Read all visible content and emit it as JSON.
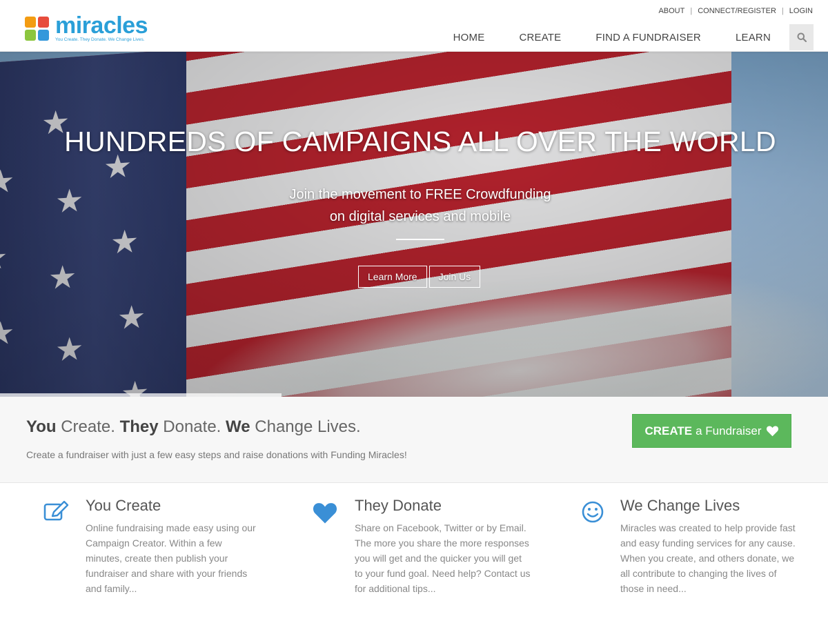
{
  "brand": {
    "name": "miracles",
    "tagline": "You Create. They Donate. We Change Lives."
  },
  "top_links": [
    "ABOUT",
    "CONNECT/REGISTER",
    "LOGIN"
  ],
  "nav": {
    "items": [
      "HOME",
      "CREATE",
      "FIND A FUNDRAISER",
      "LEARN"
    ],
    "search_icon": "search-icon"
  },
  "hero": {
    "title": "HUNDREDS OF CAMPAIGNS ALL OVER THE WORLD",
    "subtitle_line1": "Join the movement to FREE Crowdfunding",
    "subtitle_line2": "on digital services and mobile",
    "buttons": [
      "Learn More",
      "Join Us"
    ]
  },
  "band": {
    "title_parts": [
      "You",
      " Create. ",
      "They",
      " Donate. ",
      "We",
      " Change Lives."
    ],
    "description": "Create a fundraiser with just a few easy steps and raise donations with Funding Miracles!",
    "cta_bold": "CREATE",
    "cta_rest": "a Fundraiser",
    "cta_icon": "heart-icon"
  },
  "features": [
    {
      "icon": "edit-icon",
      "title": "You Create",
      "text": "Online fundraising made easy using our Campaign Creator. Within a few minutes, create then publish your fundraiser and share with your friends and family..."
    },
    {
      "icon": "heart-icon",
      "title": "They Donate",
      "text": "Share on Facebook, Twitter or by Email. The more you share the more responses you will get and the quicker you will get to your fund goal. Need help? Contact us for additional tips..."
    },
    {
      "icon": "smile-icon",
      "title": "We Change Lives",
      "text": "Miracles was created to help provide fast and easy funding services for any cause. When you create, and others donate, we all contribute to changing the lives of those in need..."
    }
  ],
  "colors": {
    "brand_blue": "#2a9fd8",
    "cta_green": "#5cb85c",
    "icon_blue": "#3a8fd6"
  }
}
